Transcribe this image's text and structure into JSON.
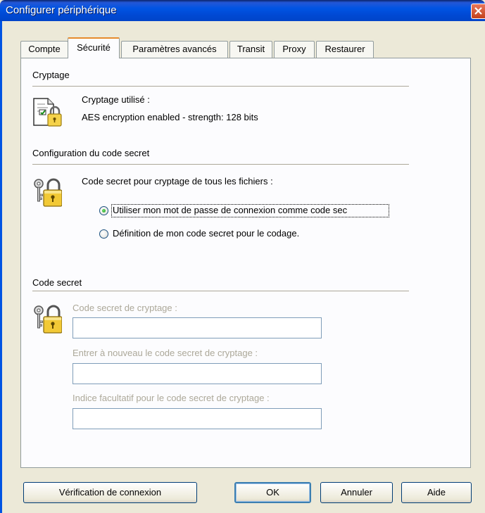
{
  "window": {
    "title": "Configurer périphérique"
  },
  "tabs": [
    {
      "label": "Compte"
    },
    {
      "label": "Sécurité",
      "active": true
    },
    {
      "label": "Paramètres avancés"
    },
    {
      "label": "Transit"
    },
    {
      "label": "Proxy"
    },
    {
      "label": "Restaurer"
    }
  ],
  "encryption": {
    "section_title": "Cryptage",
    "used_label": "Cryptage utilisé :",
    "value": "AES encryption enabled - strength: 128 bits"
  },
  "secret_config": {
    "section_title": "Configuration du code secret",
    "prompt": "Code secret pour cryptage de tous les fichiers :",
    "option_login_password": "Utiliser mon mot de passe de connexion comme code sec",
    "option_custom": "Définition de mon code secret pour le codage.",
    "selected": "option_login_password"
  },
  "secret_code": {
    "section_title": "Code secret",
    "code_label": "Code secret de cryptage :",
    "code_value": "",
    "confirm_label": "Entrer à nouveau le code secret de cryptage :",
    "confirm_value": "",
    "hint_label": "Indice facultatif pour le code secret de cryptage :",
    "hint_value": ""
  },
  "buttons": {
    "verify": "Vérification de connexion",
    "ok": "OK",
    "cancel": "Annuler",
    "help": "Aide"
  },
  "colors": {
    "titlebar": "#0054e3",
    "active_tab_accent": "#e68b2c",
    "radio_selected": "#21a121"
  }
}
